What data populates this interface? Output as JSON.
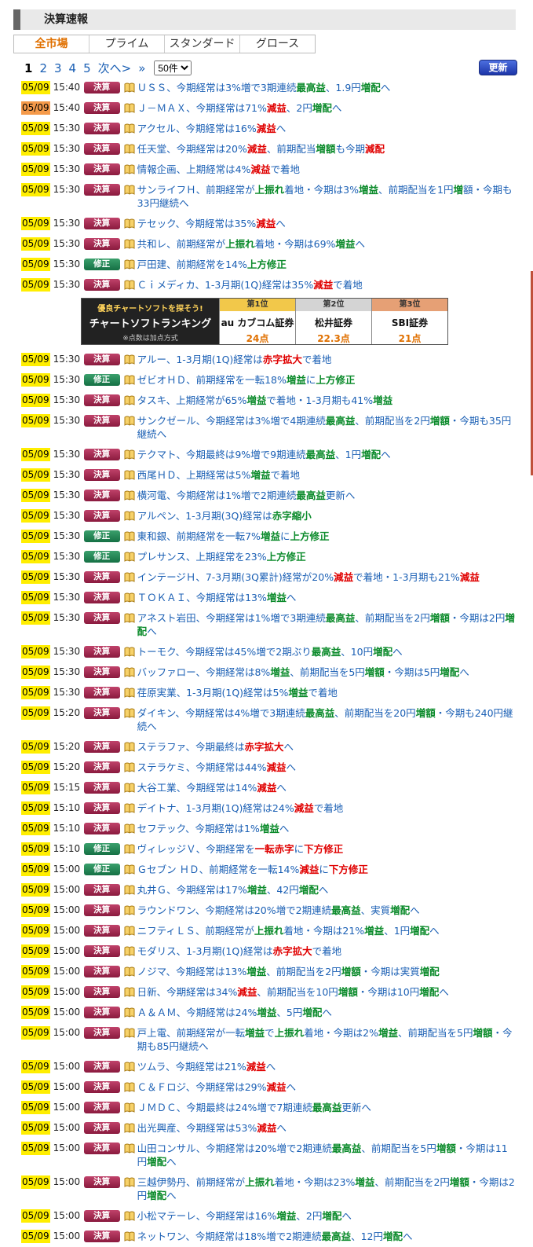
{
  "title": "決算速報",
  "tabs": [
    "全市場",
    "プライム",
    "スタンダード",
    "グロース"
  ],
  "pager": {
    "current": "1",
    "pages": [
      "2",
      "3",
      "4",
      "5"
    ],
    "next": "次へ>",
    "last": "»",
    "per_page": "50件"
  },
  "refresh_label": "更新",
  "badge_kessan": "決算",
  "badge_shusei": "修正",
  "ad": {
    "tagline": "優良チャートソフトを探そう!",
    "title": "チャートソフトランキング",
    "note": "※点数は加点方式",
    "ranks": [
      {
        "place": "第1位",
        "name": "au カブコム証券",
        "points": "24点"
      },
      {
        "place": "第2位",
        "name": "松井証券",
        "points": "22.3点"
      },
      {
        "place": "第3位",
        "name": "SBI証券",
        "points": "21点"
      }
    ]
  },
  "rows": [
    {
      "date": "05/09",
      "time": "15:40",
      "type": "kessan",
      "parts": [
        [
          "n",
          "ＵＳＳ、今期経常は3%増で3期連続"
        ],
        [
          "g",
          "最高益"
        ],
        [
          "n",
          "、1.9円"
        ],
        [
          "g",
          "増配"
        ],
        [
          "n",
          "へ"
        ]
      ]
    },
    {
      "date": "05/09",
      "time": "15:40",
      "type": "kessan",
      "orange": true,
      "parts": [
        [
          "n",
          "Ｊ－ＭＡＸ、今期経常は71%"
        ],
        [
          "r",
          "減益"
        ],
        [
          "n",
          "、2円"
        ],
        [
          "g",
          "増配"
        ],
        [
          "n",
          "へ"
        ]
      ]
    },
    {
      "date": "05/09",
      "time": "15:30",
      "type": "kessan",
      "parts": [
        [
          "n",
          "アクセル、今期経常は16%"
        ],
        [
          "r",
          "減益"
        ],
        [
          "n",
          "へ"
        ]
      ]
    },
    {
      "date": "05/09",
      "time": "15:30",
      "type": "kessan",
      "parts": [
        [
          "n",
          "任天堂、今期経常は20%"
        ],
        [
          "r",
          "減益"
        ],
        [
          "n",
          "、前期配当"
        ],
        [
          "g",
          "増額"
        ],
        [
          "n",
          "も今期"
        ],
        [
          "r",
          "減配"
        ]
      ]
    },
    {
      "date": "05/09",
      "time": "15:30",
      "type": "kessan",
      "parts": [
        [
          "n",
          "情報企画、上期経常は4%"
        ],
        [
          "r",
          "減益"
        ],
        [
          "n",
          "で着地"
        ]
      ]
    },
    {
      "date": "05/09",
      "time": "15:30",
      "type": "kessan",
      "parts": [
        [
          "n",
          "サンライフＨ、前期経常が"
        ],
        [
          "g",
          "上振れ"
        ],
        [
          "n",
          "着地・今期は3%"
        ],
        [
          "g",
          "増益"
        ],
        [
          "n",
          "、前期配当を1円"
        ],
        [
          "g",
          "増"
        ],
        [
          "n",
          "額・今期も33円継続へ"
        ]
      ]
    },
    {
      "date": "05/09",
      "time": "15:30",
      "type": "kessan",
      "parts": [
        [
          "n",
          "テセック、今期経常は35%"
        ],
        [
          "r",
          "減益"
        ],
        [
          "n",
          "へ"
        ]
      ]
    },
    {
      "date": "05/09",
      "time": "15:30",
      "type": "kessan",
      "parts": [
        [
          "n",
          "共和レ、前期経常が"
        ],
        [
          "g",
          "上振れ"
        ],
        [
          "n",
          "着地・今期は69%"
        ],
        [
          "g",
          "増益"
        ],
        [
          "n",
          "へ"
        ]
      ]
    },
    {
      "date": "05/09",
      "time": "15:30",
      "type": "shusei",
      "parts": [
        [
          "n",
          "戸田建、前期経常を14%"
        ],
        [
          "g",
          "上方修正"
        ]
      ]
    },
    {
      "date": "05/09",
      "time": "15:30",
      "type": "kessan",
      "parts": [
        [
          "n",
          "Ｃｉメディカ、1-3月期(1Q)経常は35%"
        ],
        [
          "r",
          "減益"
        ],
        [
          "n",
          "で着地"
        ]
      ]
    },
    {
      "ad": true
    },
    {
      "date": "05/09",
      "time": "15:30",
      "type": "kessan",
      "parts": [
        [
          "n",
          "アルー、1-3月期(1Q)経常は"
        ],
        [
          "r",
          "赤字拡大"
        ],
        [
          "n",
          "で着地"
        ]
      ]
    },
    {
      "date": "05/09",
      "time": "15:30",
      "type": "shusei",
      "parts": [
        [
          "n",
          "ゼビオＨＤ、前期経常を一転18%"
        ],
        [
          "g",
          "増益"
        ],
        [
          "n",
          "に"
        ],
        [
          "g",
          "上方修正"
        ]
      ]
    },
    {
      "date": "05/09",
      "time": "15:30",
      "type": "kessan",
      "parts": [
        [
          "n",
          "タスキ、上期経常が65%"
        ],
        [
          "g",
          "増益"
        ],
        [
          "n",
          "で着地・1-3月期も41%"
        ],
        [
          "g",
          "増益"
        ]
      ]
    },
    {
      "date": "05/09",
      "time": "15:30",
      "type": "kessan",
      "parts": [
        [
          "n",
          "サンクゼール、今期経常は3%増で4期連続"
        ],
        [
          "g",
          "最高益"
        ],
        [
          "n",
          "、前期配当を2円"
        ],
        [
          "g",
          "増額"
        ],
        [
          "n",
          "・今期も35円継続へ"
        ]
      ]
    },
    {
      "date": "05/09",
      "time": "15:30",
      "type": "kessan",
      "parts": [
        [
          "n",
          "テクマト、今期最終は9%増で9期連続"
        ],
        [
          "g",
          "最高益"
        ],
        [
          "n",
          "、1円"
        ],
        [
          "g",
          "増配"
        ],
        [
          "n",
          "へ"
        ]
      ]
    },
    {
      "date": "05/09",
      "time": "15:30",
      "type": "kessan",
      "parts": [
        [
          "n",
          "西尾ＨＤ、上期経常は5%"
        ],
        [
          "g",
          "増益"
        ],
        [
          "n",
          "で着地"
        ]
      ]
    },
    {
      "date": "05/09",
      "time": "15:30",
      "type": "kessan",
      "parts": [
        [
          "n",
          "横河電、今期経常は1%増で2期連続"
        ],
        [
          "g",
          "最高益"
        ],
        [
          "n",
          "更新へ"
        ]
      ]
    },
    {
      "date": "05/09",
      "time": "15:30",
      "type": "kessan",
      "parts": [
        [
          "n",
          "アルペン、1-3月期(3Q)経常は"
        ],
        [
          "g",
          "赤字縮小"
        ]
      ]
    },
    {
      "date": "05/09",
      "time": "15:30",
      "type": "shusei",
      "parts": [
        [
          "n",
          "東和銀、前期経常を一転7%"
        ],
        [
          "g",
          "増益"
        ],
        [
          "n",
          "に"
        ],
        [
          "g",
          "上方修正"
        ]
      ]
    },
    {
      "date": "05/09",
      "time": "15:30",
      "type": "shusei",
      "parts": [
        [
          "n",
          "プレサンス、上期経常を23%"
        ],
        [
          "g",
          "上方修正"
        ]
      ]
    },
    {
      "date": "05/09",
      "time": "15:30",
      "type": "kessan",
      "parts": [
        [
          "n",
          "インテージＨ、7-3月期(3Q累計)経常が20%"
        ],
        [
          "r",
          "減益"
        ],
        [
          "n",
          "で着地・1-3月期も21%"
        ],
        [
          "r",
          "減益"
        ]
      ]
    },
    {
      "date": "05/09",
      "time": "15:30",
      "type": "kessan",
      "parts": [
        [
          "n",
          "ＴＯＫＡＩ、今期経常は13%"
        ],
        [
          "g",
          "増益"
        ],
        [
          "n",
          "へ"
        ]
      ]
    },
    {
      "date": "05/09",
      "time": "15:30",
      "type": "kessan",
      "parts": [
        [
          "n",
          "アネスト岩田、今期経常は1%増で3期連続"
        ],
        [
          "g",
          "最高益"
        ],
        [
          "n",
          "、前期配当を2円"
        ],
        [
          "g",
          "増額"
        ],
        [
          "n",
          "・今期は2円"
        ],
        [
          "g",
          "増配"
        ],
        [
          "n",
          "へ"
        ]
      ]
    },
    {
      "date": "05/09",
      "time": "15:30",
      "type": "kessan",
      "parts": [
        [
          "n",
          "トーモク、今期経常は45%増で2期ぶり"
        ],
        [
          "g",
          "最高益"
        ],
        [
          "n",
          "、10円"
        ],
        [
          "g",
          "増配"
        ],
        [
          "n",
          "へ"
        ]
      ]
    },
    {
      "date": "05/09",
      "time": "15:30",
      "type": "kessan",
      "parts": [
        [
          "n",
          "バッファロー、今期経常は8%"
        ],
        [
          "g",
          "増益"
        ],
        [
          "n",
          "、前期配当を5円"
        ],
        [
          "g",
          "増額"
        ],
        [
          "n",
          "・今期は5円"
        ],
        [
          "g",
          "増配"
        ],
        [
          "n",
          "へ"
        ]
      ]
    },
    {
      "date": "05/09",
      "time": "15:30",
      "type": "kessan",
      "parts": [
        [
          "n",
          "荏原実業、1-3月期(1Q)経常は5%"
        ],
        [
          "g",
          "増益"
        ],
        [
          "n",
          "で着地"
        ]
      ]
    },
    {
      "date": "05/09",
      "time": "15:20",
      "type": "kessan",
      "parts": [
        [
          "n",
          "ダイキン、今期経常は4%増で3期連続"
        ],
        [
          "g",
          "最高益"
        ],
        [
          "n",
          "、前期配当を20円"
        ],
        [
          "g",
          "増額"
        ],
        [
          "n",
          "・今期も240円継続へ"
        ]
      ]
    },
    {
      "date": "05/09",
      "time": "15:20",
      "type": "kessan",
      "parts": [
        [
          "n",
          "ステラファ、今期最終は"
        ],
        [
          "r",
          "赤字拡大"
        ],
        [
          "n",
          "へ"
        ]
      ]
    },
    {
      "date": "05/09",
      "time": "15:20",
      "type": "kessan",
      "parts": [
        [
          "n",
          "ステラケミ、今期経常は44%"
        ],
        [
          "r",
          "減益"
        ],
        [
          "n",
          "へ"
        ]
      ]
    },
    {
      "date": "05/09",
      "time": "15:15",
      "type": "kessan",
      "parts": [
        [
          "n",
          "大谷工業、今期経常は14%"
        ],
        [
          "r",
          "減益"
        ],
        [
          "n",
          "へ"
        ]
      ]
    },
    {
      "date": "05/09",
      "time": "15:10",
      "type": "kessan",
      "parts": [
        [
          "n",
          "デイトナ、1-3月期(1Q)経常は24%"
        ],
        [
          "r",
          "減益"
        ],
        [
          "n",
          "で着地"
        ]
      ]
    },
    {
      "date": "05/09",
      "time": "15:10",
      "type": "kessan",
      "parts": [
        [
          "n",
          "セフテック、今期経常は1%"
        ],
        [
          "g",
          "増益"
        ],
        [
          "n",
          "へ"
        ]
      ]
    },
    {
      "date": "05/09",
      "time": "15:10",
      "type": "shusei",
      "parts": [
        [
          "n",
          "ヴィレッジＶ、今期経常を"
        ],
        [
          "r",
          "一転赤字"
        ],
        [
          "n",
          "に"
        ],
        [
          "r",
          "下方修正"
        ]
      ]
    },
    {
      "date": "05/09",
      "time": "15:00",
      "type": "shusei",
      "parts": [
        [
          "n",
          "Ｇセブン ＨＤ、前期経常を一転14%"
        ],
        [
          "r",
          "減益"
        ],
        [
          "n",
          "に"
        ],
        [
          "r",
          "下方修正"
        ]
      ]
    },
    {
      "date": "05/09",
      "time": "15:00",
      "type": "kessan",
      "parts": [
        [
          "n",
          "丸井Ｇ、今期経常は17%"
        ],
        [
          "g",
          "増益"
        ],
        [
          "n",
          "、42円"
        ],
        [
          "g",
          "増配"
        ],
        [
          "n",
          "へ"
        ]
      ]
    },
    {
      "date": "05/09",
      "time": "15:00",
      "type": "kessan",
      "parts": [
        [
          "n",
          "ラウンドワン、今期経常は20%増で2期連続"
        ],
        [
          "g",
          "最高益"
        ],
        [
          "n",
          "、実質"
        ],
        [
          "g",
          "増配"
        ],
        [
          "n",
          "へ"
        ]
      ]
    },
    {
      "date": "05/09",
      "time": "15:00",
      "type": "kessan",
      "parts": [
        [
          "n",
          "ニフティＬＳ、前期経常が"
        ],
        [
          "g",
          "上振れ"
        ],
        [
          "n",
          "着地・今期は21%"
        ],
        [
          "g",
          "増益"
        ],
        [
          "n",
          "、1円"
        ],
        [
          "g",
          "増配"
        ],
        [
          "n",
          "へ"
        ]
      ]
    },
    {
      "date": "05/09",
      "time": "15:00",
      "type": "kessan",
      "parts": [
        [
          "n",
          "モダリス、1-3月期(1Q)経常は"
        ],
        [
          "r",
          "赤字拡大"
        ],
        [
          "n",
          "で着地"
        ]
      ]
    },
    {
      "date": "05/09",
      "time": "15:00",
      "type": "kessan",
      "parts": [
        [
          "n",
          "ノジマ、今期経常は13%"
        ],
        [
          "g",
          "増益"
        ],
        [
          "n",
          "、前期配当を2円"
        ],
        [
          "g",
          "増額"
        ],
        [
          "n",
          "・今期は実質"
        ],
        [
          "g",
          "増配"
        ]
      ]
    },
    {
      "date": "05/09",
      "time": "15:00",
      "type": "kessan",
      "parts": [
        [
          "n",
          "日新、今期経常は34%"
        ],
        [
          "r",
          "減益"
        ],
        [
          "n",
          "、前期配当を10円"
        ],
        [
          "g",
          "増額"
        ],
        [
          "n",
          "・今期は10円"
        ],
        [
          "g",
          "増配"
        ],
        [
          "n",
          "へ"
        ]
      ]
    },
    {
      "date": "05/09",
      "time": "15:00",
      "type": "kessan",
      "parts": [
        [
          "n",
          "Ａ＆ＡＭ、今期経常は24%"
        ],
        [
          "g",
          "増益"
        ],
        [
          "n",
          "、5円"
        ],
        [
          "g",
          "増配"
        ],
        [
          "n",
          "へ"
        ]
      ]
    },
    {
      "date": "05/09",
      "time": "15:00",
      "type": "kessan",
      "parts": [
        [
          "n",
          "戸上電、前期経常が一転"
        ],
        [
          "g",
          "増益"
        ],
        [
          "n",
          "で"
        ],
        [
          "g",
          "上振れ"
        ],
        [
          "n",
          "着地・今期は2%"
        ],
        [
          "g",
          "増益"
        ],
        [
          "n",
          "、前期配当を5円"
        ],
        [
          "g",
          "増額"
        ],
        [
          "n",
          "・今期も85円継続へ"
        ]
      ]
    },
    {
      "date": "05/09",
      "time": "15:00",
      "type": "kessan",
      "parts": [
        [
          "n",
          "ツムラ、今期経常は21%"
        ],
        [
          "r",
          "減益"
        ],
        [
          "n",
          "へ"
        ]
      ]
    },
    {
      "date": "05/09",
      "time": "15:00",
      "type": "kessan",
      "parts": [
        [
          "n",
          "Ｃ＆Ｆロジ、今期経常は29%"
        ],
        [
          "r",
          "減益"
        ],
        [
          "n",
          "へ"
        ]
      ]
    },
    {
      "date": "05/09",
      "time": "15:00",
      "type": "kessan",
      "parts": [
        [
          "n",
          "ＪＭＤＣ、今期最終は24%増で7期連続"
        ],
        [
          "g",
          "最高益"
        ],
        [
          "n",
          "更新へ"
        ]
      ]
    },
    {
      "date": "05/09",
      "time": "15:00",
      "type": "kessan",
      "parts": [
        [
          "n",
          "出光興産、今期経常は53%"
        ],
        [
          "r",
          "減益"
        ],
        [
          "n",
          "へ"
        ]
      ]
    },
    {
      "date": "05/09",
      "time": "15:00",
      "type": "kessan",
      "parts": [
        [
          "n",
          "山田コンサル、今期経常は20%増で2期連続"
        ],
        [
          "g",
          "最高益"
        ],
        [
          "n",
          "、前期配当を5円"
        ],
        [
          "g",
          "増額"
        ],
        [
          "n",
          "・今期は11円"
        ],
        [
          "g",
          "増配"
        ],
        [
          "n",
          "へ"
        ]
      ]
    },
    {
      "date": "05/09",
      "time": "15:00",
      "type": "kessan",
      "parts": [
        [
          "n",
          "三越伊勢丹、前期経常が"
        ],
        [
          "g",
          "上振れ"
        ],
        [
          "n",
          "着地・今期は23%"
        ],
        [
          "g",
          "増益"
        ],
        [
          "n",
          "、前期配当を2円"
        ],
        [
          "g",
          "増額"
        ],
        [
          "n",
          "・今期は2円"
        ],
        [
          "g",
          "増配"
        ],
        [
          "n",
          "へ"
        ]
      ]
    },
    {
      "date": "05/09",
      "time": "15:00",
      "type": "kessan",
      "parts": [
        [
          "n",
          "小松マテーレ、今期経常は16%"
        ],
        [
          "g",
          "増益"
        ],
        [
          "n",
          "、2円"
        ],
        [
          "g",
          "増配"
        ],
        [
          "n",
          "へ"
        ]
      ]
    },
    {
      "date": "05/09",
      "time": "15:00",
      "type": "kessan",
      "parts": [
        [
          "n",
          "ネットワン、今期経常は18%増で2期連続"
        ],
        [
          "g",
          "最高益"
        ],
        [
          "n",
          "、12円"
        ],
        [
          "g",
          "増配"
        ],
        [
          "n",
          "へ"
        ]
      ]
    }
  ]
}
